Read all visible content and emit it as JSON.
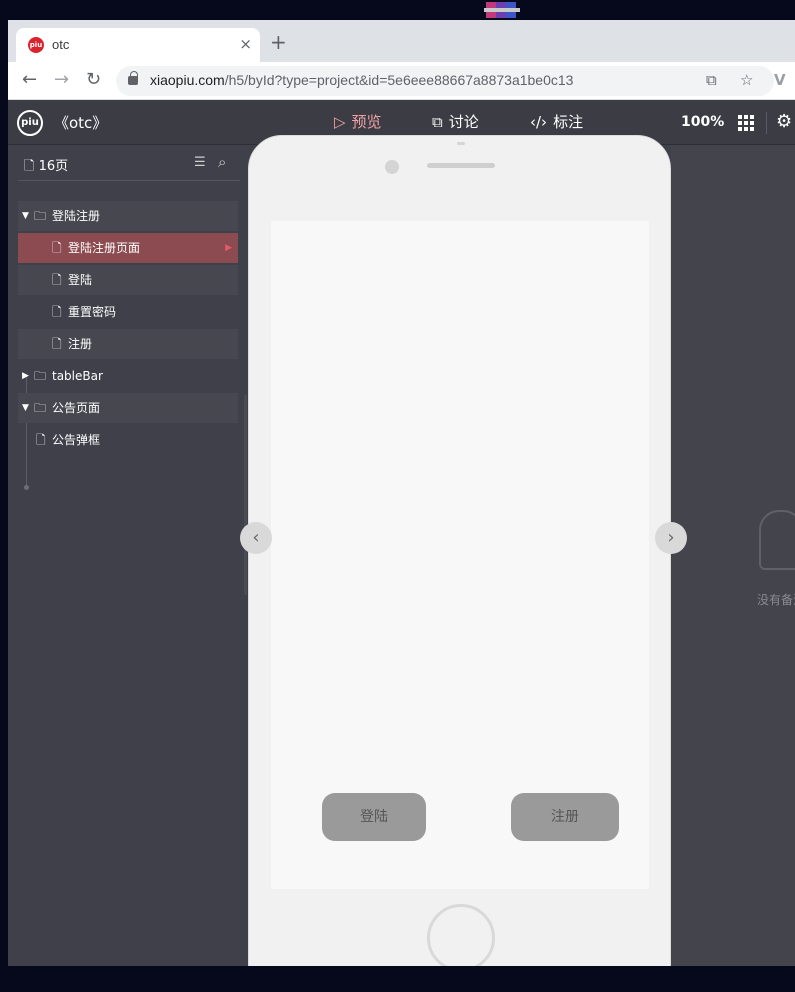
{
  "browser": {
    "tab_title": "otc",
    "tab_close": "×",
    "new_tab": "+",
    "url_host": "xiaopiu.com",
    "url_path": "/h5/byId?type=project&id=5e6eee88667a8873a1be0c13",
    "back": "←",
    "forward": "→",
    "reload": "↻",
    "install_icon": "⧉",
    "star_icon": "☆",
    "ext_icon": "V",
    "favicon_text": "piu"
  },
  "app": {
    "logo_text": "piu",
    "project_title": "《otc》",
    "tabs": [
      {
        "label": "预览",
        "icon": "▷"
      },
      {
        "label": "讨论",
        "icon": "⧉"
      },
      {
        "label": "标注",
        "icon": "‹/›"
      }
    ],
    "zoom": "100%",
    "gear": "⚙"
  },
  "sidebar": {
    "pages_label": "16页",
    "filter_icon": "☰",
    "search_icon": "⌕",
    "tree": [
      {
        "label": "登陆注册",
        "type": "folder",
        "expanded": true,
        "selected": false
      },
      {
        "label": "登陆注册页面",
        "type": "page",
        "selected": true
      },
      {
        "label": "登陆",
        "type": "page",
        "selected": false
      },
      {
        "label": "重置密码",
        "type": "page",
        "selected": false
      },
      {
        "label": "注册",
        "type": "page",
        "selected": false
      },
      {
        "label": "tableBar",
        "type": "folder",
        "expanded": false,
        "selected": false
      },
      {
        "label": "公告页面",
        "type": "folder",
        "expanded": true,
        "selected": false
      },
      {
        "label": "公告弹框",
        "type": "page",
        "selected": false
      }
    ]
  },
  "phone": {
    "login_button": "登陆",
    "register_button": "注册"
  },
  "canvas": {
    "prev_arrow": "‹",
    "next_arrow": "›",
    "empty_text": "没有备注"
  },
  "colors": {
    "accent": "#f2a2a6",
    "selected_row": "#8c4b50",
    "app_bg": "#3f4049",
    "button_gray": "#9a9a9a"
  }
}
